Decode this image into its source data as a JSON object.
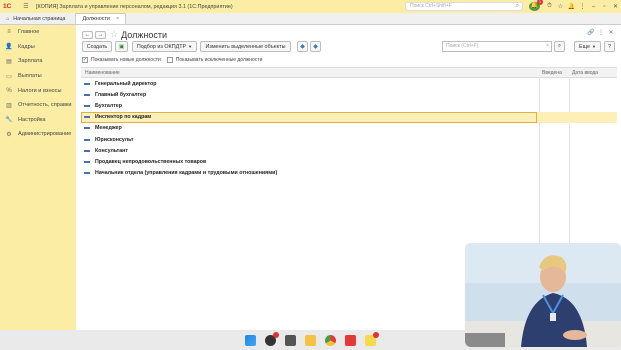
{
  "titlebar": {
    "logo": "1С",
    "app_title": "[КОПИЯ] Зарплата и управление персоналом, редакция 3.1  (1С:Предприятие)",
    "search_placeholder": "Поиск Ctrl+Shift+F",
    "notification_count": "1"
  },
  "tabs": {
    "home_label": "Начальная страница",
    "active_label": "Должности"
  },
  "sidebar": {
    "items": [
      {
        "label": "Главное",
        "icon": "menu-icon"
      },
      {
        "label": "Кадры",
        "icon": "person-icon"
      },
      {
        "label": "Зарплата",
        "icon": "wallet-icon"
      },
      {
        "label": "Выплаты",
        "icon": "cash-icon"
      },
      {
        "label": "Налоги и взносы",
        "icon": "percent-icon"
      },
      {
        "label": "Отчетность, справки",
        "icon": "report-icon"
      },
      {
        "label": "Настройка",
        "icon": "wrench-icon"
      },
      {
        "label": "Администрирование",
        "icon": "gear-icon"
      }
    ]
  },
  "page": {
    "title": "Должности"
  },
  "toolbar": {
    "create_label": "Создать",
    "okpdtr_label": "Подбор из ОКПДТР",
    "change_selected_label": "Изменить выделенные объекты",
    "search_placeholder": "Поиск (Ctrl+F)",
    "more_label": "Еще",
    "help_label": "?"
  },
  "filters": {
    "show_new_label": "Показывать новые должности",
    "show_new_checked": true,
    "show_excluded_label": "Показывать исключенные должности",
    "show_excluded_checked": false
  },
  "table": {
    "columns": [
      "Наименование",
      "Введена",
      "Дата ввода"
    ],
    "rows": [
      "Генеральный директор",
      "Главный бухгалтер",
      "Бухгалтер",
      "Инспектор по кадрам",
      "Менеджер",
      "Юрисконсульт",
      "Консультант",
      "Продавец непродовольственных товаров",
      "Начальник отдела (управления кадрами и трудовыми отношениями)"
    ],
    "selected_row": 3
  },
  "colors": {
    "accent_yellow": "#fbeea4",
    "selection": "#fcefb8",
    "row_marker": "#4a70b0"
  },
  "taskbar": {
    "icons": [
      "windows-icon",
      "search-icon",
      "app-icon",
      "explorer-icon",
      "chrome-icon",
      "app-red-icon",
      "1c-icon"
    ]
  }
}
